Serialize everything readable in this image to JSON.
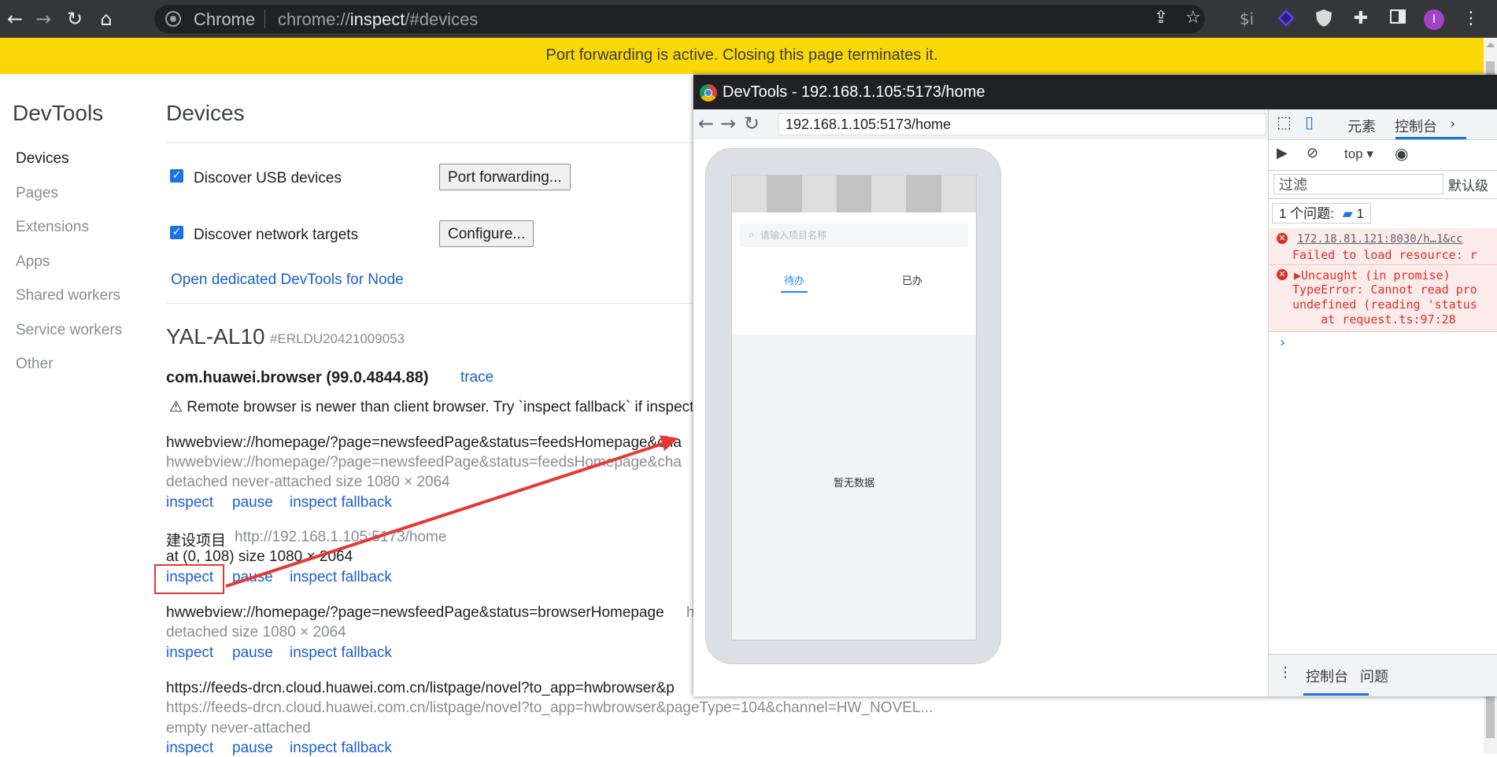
{
  "browser": {
    "chip_label": "Chrome",
    "url_host": "chrome://",
    "url_path": "inspect",
    "url_hash": "/#devices",
    "ext_label": "$i",
    "avatar_letter": "I",
    "icons": [
      "back-icon",
      "forward-icon",
      "reload-icon",
      "home-icon",
      "share-icon",
      "star-icon",
      "extension-icon",
      "puzzle-icon",
      "sidepanel-icon",
      "menu-icon"
    ]
  },
  "banner": {
    "text": "Port forwarding is active. Closing this page terminates it."
  },
  "sidebar": {
    "title": "DevTools",
    "items": [
      {
        "label": "Devices",
        "active": true
      },
      {
        "label": "Pages",
        "active": false
      },
      {
        "label": "Extensions",
        "active": false
      },
      {
        "label": "Apps",
        "active": false
      },
      {
        "label": "Shared workers",
        "active": false
      },
      {
        "label": "Service workers",
        "active": false
      },
      {
        "label": "Other",
        "active": false
      }
    ]
  },
  "main": {
    "title": "Devices",
    "discover_usb": {
      "label": "Discover USB devices",
      "checked": true
    },
    "port_forwarding_btn": "Port forwarding...",
    "discover_network": {
      "label": "Discover network targets",
      "checked": true
    },
    "configure_btn": "Configure...",
    "node_link": "Open dedicated DevTools for Node",
    "device": {
      "name": "YAL-AL10",
      "serial": "#ERLDU20421009053",
      "browser_name": "com.huawei.browser (99.0.4844.88)",
      "trace_link": "trace",
      "warning": "⚠ Remote browser is newer than client browser. Try `inspect fallback` if inspect",
      "targets": [
        {
          "title": "hwwebview://homepage/?page=newsfeedPage&status=feedsHomepage&cha",
          "url": "hwwebview://homepage/?page=newsfeedPage&status=feedsHomepage&cha",
          "meta": "detached never-attached  size 1080 × 2064",
          "actions": [
            "inspect",
            "pause",
            "inspect fallback"
          ]
        },
        {
          "title": "建设项目",
          "url": "http://192.168.1.105:5173/home",
          "meta": "at (0, 108)  size 1080 × 2064",
          "actions": [
            "inspect",
            "pause",
            "inspect fallback"
          ]
        },
        {
          "title": "hwwebview://homepage/?page=newsfeedPage&status=browserHomepage",
          "url": "h",
          "meta": "detached  size 1080 × 2064",
          "actions": [
            "inspect",
            "pause",
            "inspect fallback"
          ]
        },
        {
          "title": "https://feeds-drcn.cloud.huawei.com.cn/listpage/novel?to_app=hwbrowser&p",
          "url": "https://feeds-drcn.cloud.huawei.com.cn/listpage/novel?to_app=hwbrowser&pageType=104&channel=HW_NOVEL...",
          "meta": "empty never-attached",
          "actions": [
            "inspect",
            "pause",
            "inspect fallback"
          ]
        }
      ]
    }
  },
  "devtools_window": {
    "title": "DevTools - 192.168.1.105:5173/home",
    "url": "192.168.1.105:5173/home",
    "app": {
      "search_placeholder": "请输入项目名称",
      "tab_pending": "待办",
      "tab_done": "已办",
      "empty_text": "暂无数据",
      "active_tab_color": "#1989fa"
    },
    "panel": {
      "tab_elements": "元素",
      "tab_console": "控制台",
      "context": "top",
      "filter_placeholder": "过滤",
      "level": "默认级",
      "issues_label": "1 个问题:",
      "issues_count": "1",
      "errors": [
        {
          "source": "172.18.81.121:8030/h…1&cc",
          "lines": [
            "Failed to load resource: r"
          ]
        },
        {
          "source": "",
          "lines": [
            "▶Uncaught (in promise)",
            "TypeError: Cannot read pro",
            "undefined (reading 'status",
            "    at request.ts:97:28"
          ]
        }
      ],
      "prompt": "›",
      "drawer_tab_console": "控制台",
      "drawer_tab_issues": "问题"
    }
  },
  "colors": {
    "banner": "#f9d805",
    "link": "#1a5fd0",
    "checkbox": "#1a73e8",
    "error": "#d93025",
    "annotation": "#e53935"
  }
}
